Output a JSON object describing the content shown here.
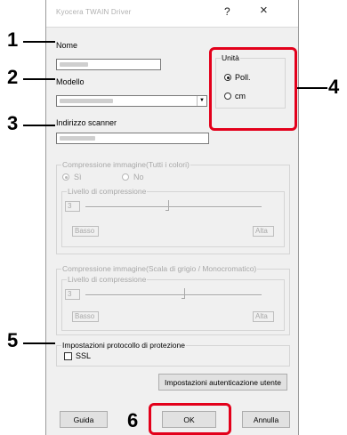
{
  "window": {
    "title": "Kyocera TWAIN Driver",
    "help": "?",
    "close": "×"
  },
  "fields": {
    "name_label": "Nome",
    "model_label": "Modello",
    "scanner_address_label": "Indirizzo scanner"
  },
  "units": {
    "title": "Unità",
    "inch_label": "Poll.",
    "cm_label": "cm",
    "selected": "Poll."
  },
  "compression_color": {
    "title": "Compressione immagine(Tutti i colori)",
    "yes_label": "Sì",
    "no_label": "No",
    "level_title": "Livello di compressione",
    "level_value": "3",
    "low_label": "Basso",
    "high_label": "Alta"
  },
  "compression_gray": {
    "title": "Compressione immagine(Scala di grigio / Monocromatico)",
    "level_title": "Livello di compressione",
    "level_value": "3",
    "low_label": "Basso",
    "high_label": "Alta"
  },
  "security": {
    "title": "Impostazioni protocollo di protezione",
    "ssl_label": "SSL",
    "ssl_checked": false
  },
  "buttons": {
    "auth": "Impostazioni autenticazione utente",
    "help": "Guida",
    "ok": "OK",
    "cancel": "Annulla"
  },
  "callouts": {
    "c1": "1",
    "c2": "2",
    "c3": "3",
    "c4": "4",
    "c5": "5",
    "c6": "6"
  },
  "colors": {
    "callout_red": "#e3001b",
    "dialog_bg": "#f0f0f0"
  }
}
